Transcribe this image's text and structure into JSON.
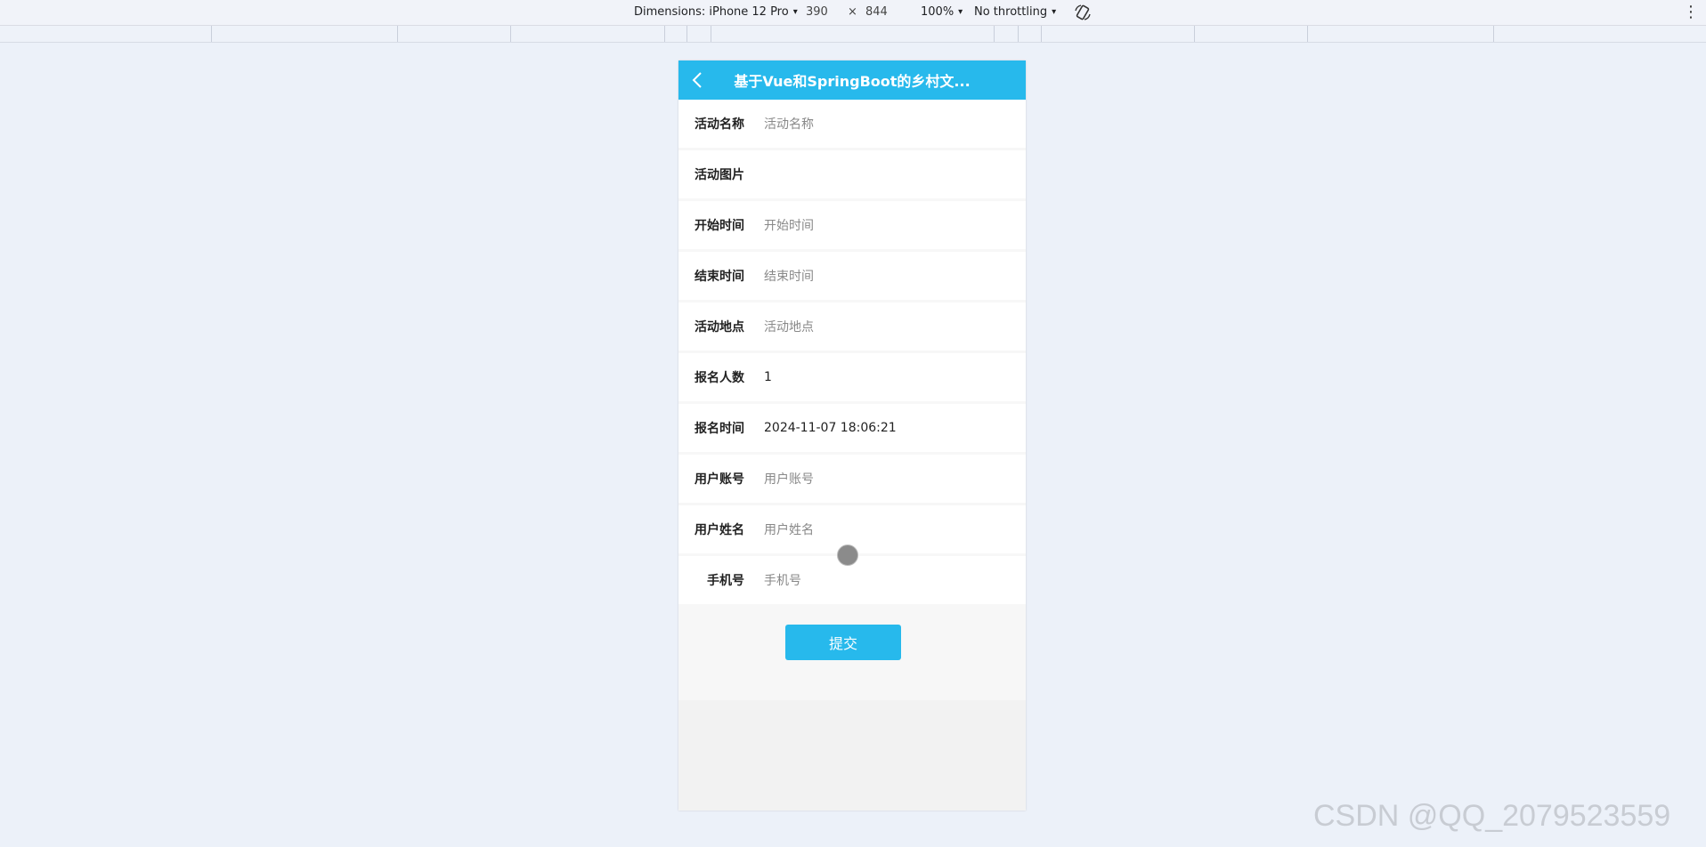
{
  "devtools": {
    "dimensions_label": "Dimensions: iPhone 12 Pro",
    "width": "390",
    "times": "×",
    "height": "844",
    "zoom": "100%",
    "throttling": "No throttling",
    "caret": "▾",
    "more": "⋮"
  },
  "header": {
    "title": "基于Vue和SpringBoot的乡村文..."
  },
  "form": {
    "fields": [
      {
        "label": "活动名称",
        "value": "活动名称",
        "filled": false
      },
      {
        "label": "活动图片",
        "value": "",
        "filled": false
      },
      {
        "label": "开始时间",
        "value": "开始时间",
        "filled": false
      },
      {
        "label": "结束时间",
        "value": "结束时间",
        "filled": false
      },
      {
        "label": "活动地点",
        "value": "活动地点",
        "filled": false
      },
      {
        "label": "报名人数",
        "value": "1",
        "filled": true
      },
      {
        "label": "报名时间",
        "value": "2024-11-07 18:06:21",
        "filled": true
      },
      {
        "label": "用户账号",
        "value": "用户账号",
        "filled": false
      },
      {
        "label": "用户姓名",
        "value": "用户姓名",
        "filled": false
      },
      {
        "label": "手机号",
        "value": "手机号",
        "filled": false
      }
    ],
    "submit_label": "提交"
  },
  "watermark": "CSDN @QQ_2079523559",
  "colors": {
    "accent": "#27b9ec",
    "background": "#ecf1f9"
  }
}
